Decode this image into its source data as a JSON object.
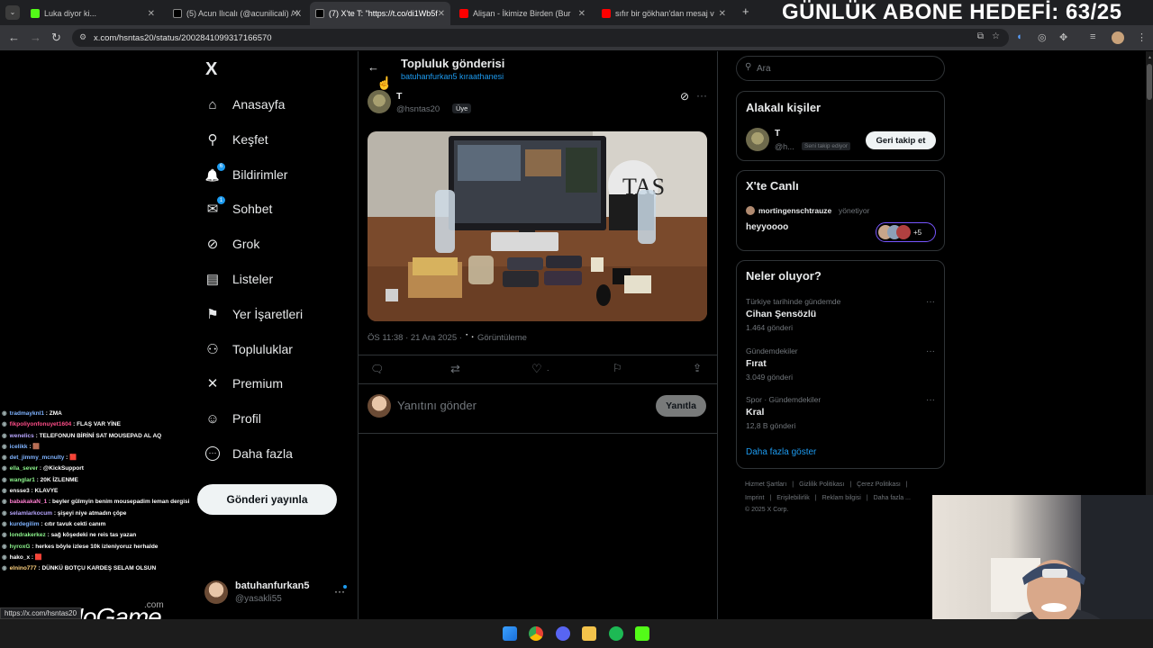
{
  "browser": {
    "tabs": [
      {
        "title": "Luka diyor ki...",
        "fav_color": "#53fc18"
      },
      {
        "title": "(5) Acun Ilıcalı (@acunilicali) / X",
        "fav_color": "#000000"
      },
      {
        "title": "(7) X'te T: \"https://t.co/di1Wb5f",
        "fav_color": "#000000",
        "active": true
      },
      {
        "title": "Alişan - İkimize Birden (Bur",
        "fav_color": "#ff0000"
      },
      {
        "title": "sıfır bir gökhan'dan mesaj v",
        "fav_color": "#ff0000"
      }
    ],
    "url": "x.com/hsntas20/status/2002841099317166570",
    "status_url": "https://x.com/hsntas20",
    "new_tab": "+"
  },
  "overlay": {
    "goal_text": "GÜNLÜK ABONE HEDEFİ: 63/25",
    "watermark": "ByNoGame",
    "watermark_suffix": ".com"
  },
  "nav": {
    "logo": "X",
    "items": [
      {
        "label": "Anasayfa",
        "icon": "home-icon",
        "glyph": "⌂"
      },
      {
        "label": "Keşfet",
        "icon": "search-icon",
        "glyph": "⚲"
      },
      {
        "label": "Bildirimler",
        "icon": "bell-icon",
        "glyph": "🔔",
        "badge": "6"
      },
      {
        "label": "Sohbet",
        "icon": "mail-icon",
        "glyph": "✉",
        "badge": "1"
      },
      {
        "label": "Grok",
        "icon": "grok-icon",
        "glyph": "⊘"
      },
      {
        "label": "Listeler",
        "icon": "list-icon",
        "glyph": "▤"
      },
      {
        "label": "Yer İşaretleri",
        "icon": "bookmark-icon",
        "glyph": "⚑"
      },
      {
        "label": "Topluluklar",
        "icon": "communities-icon",
        "glyph": "⚇"
      },
      {
        "label": "Premium",
        "icon": "x-premium-icon",
        "glyph": "✕"
      },
      {
        "label": "Profil",
        "icon": "profile-icon",
        "glyph": "☺"
      },
      {
        "label": "Daha fazla",
        "icon": "more-circle-icon",
        "glyph": "⋯"
      }
    ],
    "post_button": "Gönderi yayınla",
    "account": {
      "name": "batuhanfurkan5",
      "handle": "@yasakli55"
    }
  },
  "post": {
    "header_title": "Topluluk gönderisi",
    "header_sub": "batuhanfurkan5 kıraathanesi",
    "author_name": "T",
    "author_handle": "@hsntas20",
    "member_badge": "Üye",
    "meta_time": "ÖS 11:38 · 21 Ara 2025 ·",
    "views_label": "Görüntüleme",
    "like_count": ".",
    "reply_placeholder": "Yanıtını gönder",
    "reply_button": "Yanıtla"
  },
  "right": {
    "search_placeholder": "Ara",
    "relevant_title": "Alakalı kişiler",
    "relevant_user": {
      "name": "T",
      "handle": "@h...",
      "follows_you": "Seni takip ediyor",
      "button": "Geri takip et"
    },
    "live_title": "X'te Canlı",
    "live_host": "mortingenschtrauze",
    "live_role": "yönetiyor",
    "live_room": "heyyoooo",
    "live_more": "+5",
    "trends_title": "Neler oluyor?",
    "trends": [
      {
        "category": "Türkiye tarihinde gündemde",
        "name": "Cihan Şensözlü",
        "count": "1.464 gönderi"
      },
      {
        "category": "Gündemdekiler",
        "name": "Fırat",
        "count": "3.049 gönderi"
      },
      {
        "category": "Spor · Gündemdekiler",
        "name": "Kral",
        "count": "12,8 B gönderi"
      }
    ],
    "show_more": "Daha fazla göster",
    "footer_row1": [
      "Hizmet Şartları",
      "Gizlilik Politikası",
      "Çerez Politikası"
    ],
    "footer_row2": [
      "Imprint",
      "Erişilebilirlik",
      "Reklam bilgisi",
      "Daha fazla ..."
    ],
    "copyright": "© 2025 X Corp."
  },
  "chat": [
    {
      "user": "tradmayknl1",
      "msg": "ZMA",
      "color": "#7fb3ff"
    },
    {
      "user": "fikpoliyonfonuyet1604",
      "msg": "FLAŞ VAR YİNE",
      "color": "#ff4d88"
    },
    {
      "user": "wenelics",
      "msg": "TELEFONUN BİRİNİ SAT MOUSEPAD AL AQ",
      "color": "#b8a6ff"
    },
    {
      "user": "icelikk",
      "msg": "🟫",
      "color": "#7fb3ff"
    },
    {
      "user": "det_jimmy_mcnulty",
      "msg": "🟥",
      "color": "#7fb3ff"
    },
    {
      "user": "ella_sever",
      "msg": "@KickSupport",
      "color": "#8df58d"
    },
    {
      "user": "wanglar1",
      "msg": "20K İZLENME",
      "color": "#8df58d"
    },
    {
      "user": "ensse3",
      "msg": "KLAVYE",
      "color": "#ffffff"
    },
    {
      "user": "babakakaN_1",
      "msg": "beyler gülmyin benim mousepadim leman dergisi",
      "color": "#ff7fd0"
    },
    {
      "user": "selamlarkocum",
      "msg": "şişeyi niye atmadın çöpe",
      "color": "#b8a6ff"
    },
    {
      "user": "kurdegilim",
      "msg": "cıtır tavuk cekti canım",
      "color": "#7fb3ff"
    },
    {
      "user": "londrakerkez",
      "msg": "sağ köşedeki ne reis tas yazan",
      "color": "#8df58d"
    },
    {
      "user": "hyroxG",
      "msg": "herkes böyle izlese 10k izleniyoruz herhalde",
      "color": "#8df58d"
    },
    {
      "user": "hako_x",
      "msg": "🟥",
      "color": "#ffffff"
    },
    {
      "user": "elnino777",
      "msg": "DÜNKÜ BOTÇU KARDEŞ SELAM OLSUN",
      "color": "#ffd27f"
    }
  ]
}
